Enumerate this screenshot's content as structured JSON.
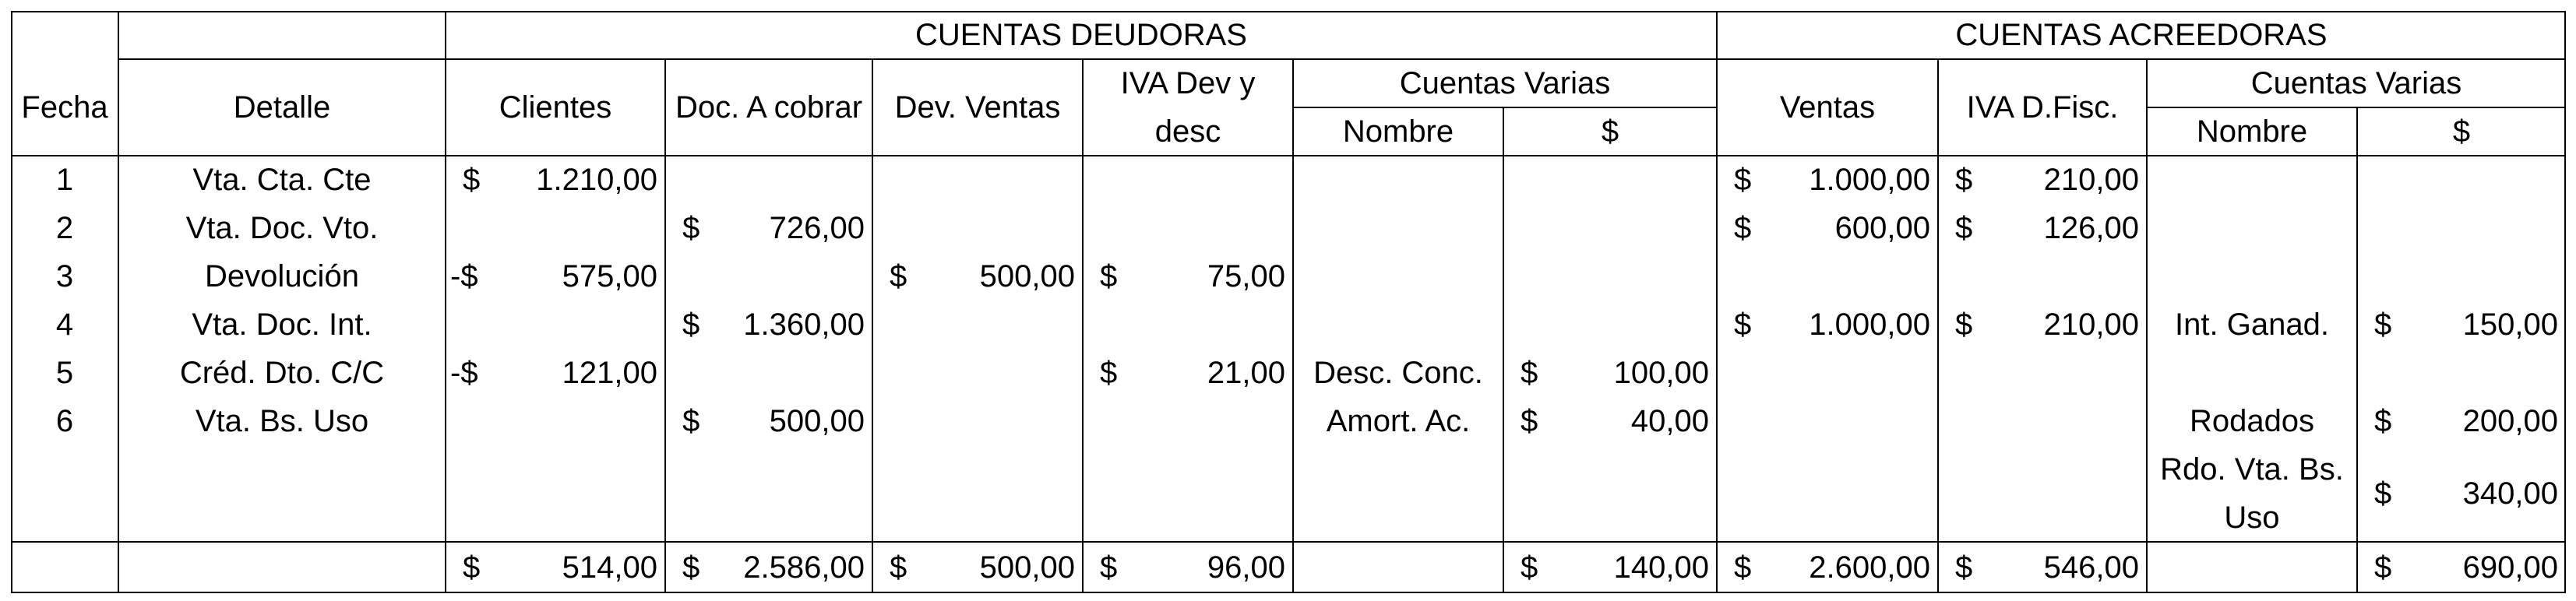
{
  "headers": {
    "deudoras": "CUENTAS DEUDORAS",
    "acreedoras": "CUENTAS ACREEDORAS",
    "fecha": "Fecha",
    "detalle": "Detalle",
    "clientes": "Clientes",
    "doc_cobrar": "Doc. A cobrar",
    "dev_ventas": "Dev. Ventas",
    "iva_dev_line1": "IVA Dev y",
    "iva_dev_line2": "desc",
    "cuentas_varias_d": "Cuentas Varias",
    "nombre_d": "Nombre",
    "pesos_d": "$",
    "ventas": "Ventas",
    "iva_dfisc": "IVA D.Fisc.",
    "cuentas_varias_a": "Cuentas Varias",
    "nombre_a": "Nombre",
    "pesos_a": "$"
  },
  "currency": "$",
  "rows": [
    {
      "fecha": "1",
      "detalle": "Vta. Cta. Cte",
      "clientes": "1.210,00",
      "ventas": "1.000,00",
      "iva_df": "210,00"
    },
    {
      "fecha": "2",
      "detalle": "Vta. Doc. Vto.",
      "doc_cobrar": "726,00",
      "ventas": "600,00",
      "iva_df": "126,00"
    },
    {
      "fecha": "3",
      "detalle": "Devolución",
      "clientes_neg": "575,00",
      "dev_ventas": "500,00",
      "iva_dev": "75,00"
    },
    {
      "fecha": "4",
      "detalle": "Vta. Doc. Int.",
      "doc_cobrar": "1.360,00",
      "ventas": "1.000,00",
      "iva_df": "210,00",
      "nombre_a": "Int. Ganad.",
      "valor_a": "150,00"
    },
    {
      "fecha": "5",
      "detalle": "Créd. Dto. C/C",
      "clientes_neg": "121,00",
      "iva_dev": "21,00",
      "nombre_d": "Desc. Conc.",
      "valor_d": "100,00"
    },
    {
      "fecha": "6",
      "detalle": "Vta. Bs. Uso",
      "doc_cobrar": "500,00",
      "nombre_d": "Amort. Ac.",
      "valor_d": "40,00",
      "nombre_a": "Rodados",
      "valor_a": "200,00"
    }
  ],
  "extra_row": {
    "nombre_a_line1": "Rdo. Vta. Bs.",
    "nombre_a_line2": "Uso",
    "valor_a": "340,00"
  },
  "totals": {
    "clientes": "514,00",
    "doc_cobrar": "2.586,00",
    "dev_ventas": "500,00",
    "iva_dev": "96,00",
    "valor_d": "140,00",
    "ventas": "2.600,00",
    "iva_df": "546,00",
    "valor_a": "690,00"
  }
}
